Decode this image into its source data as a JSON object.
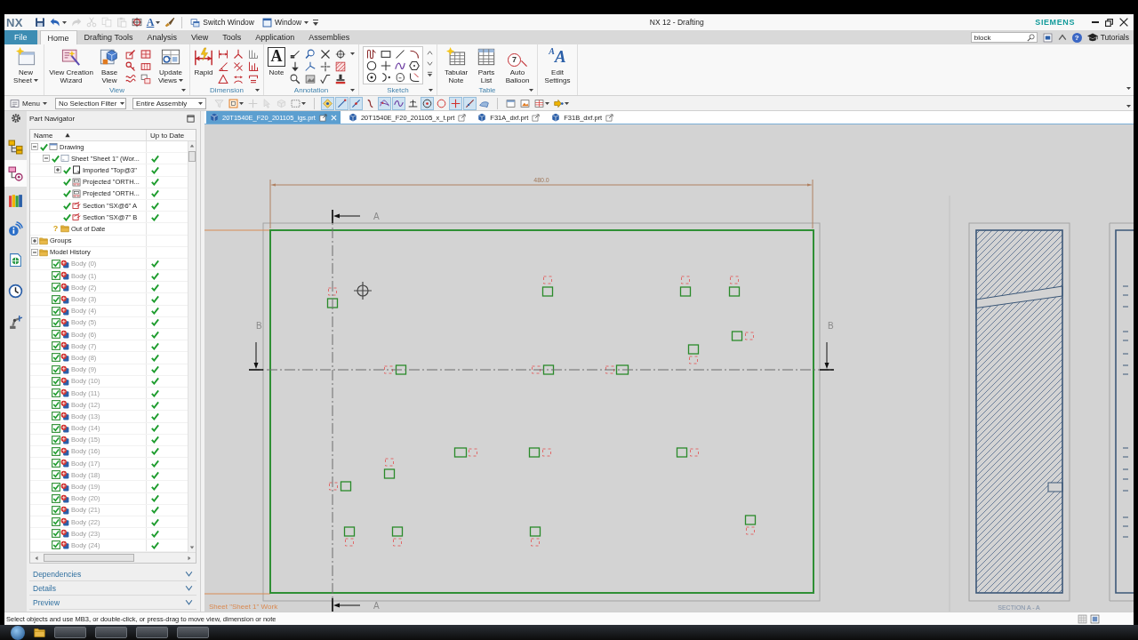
{
  "window": {
    "logo": "NX",
    "title": "NX 12 - Drafting",
    "brand": "SIEMENS"
  },
  "quick_access": {
    "tools": [
      {
        "kind": "save",
        "disabled": false
      },
      {
        "kind": "undo",
        "disabled": false
      },
      {
        "kind": "redo",
        "disabled": true
      },
      {
        "kind": "cut",
        "disabled": true
      },
      {
        "kind": "copy",
        "disabled": true
      },
      {
        "kind": "paste",
        "disabled": true
      },
      {
        "kind": "repeat",
        "disabled": false
      },
      {
        "kind": "text_style",
        "glyph": "A",
        "disabled": false
      },
      {
        "kind": "brush",
        "disabled": false
      }
    ],
    "buttons": [
      {
        "kind": "switch_window",
        "label": "Switch Window"
      },
      {
        "kind": "window",
        "label": "Window"
      }
    ]
  },
  "ribbon": {
    "tabs": [
      {
        "kind": "file",
        "label": "File",
        "selected": false
      },
      {
        "kind": "tab",
        "label": "Home",
        "selected": true
      },
      {
        "kind": "tab",
        "label": "Drafting Tools",
        "selected": false
      },
      {
        "kind": "tab",
        "label": "Analysis",
        "selected": false
      },
      {
        "kind": "tab",
        "label": "View",
        "selected": false
      },
      {
        "kind": "tab",
        "label": "Tools",
        "selected": false
      },
      {
        "kind": "tab",
        "label": "Application",
        "selected": false
      },
      {
        "kind": "tab",
        "label": "Assemblies",
        "selected": false
      }
    ],
    "search": {
      "value": "block"
    },
    "help": "?",
    "tutorials": "Tutorials",
    "groups": [
      {
        "kind": "sheet",
        "buttons": [
          {
            "kind": "new_sheet",
            "label": "New Sheet",
            "dropdown": true
          }
        ]
      },
      {
        "kind": "view",
        "label": "View",
        "buttons": [
          {
            "kind": "view_wizard",
            "label": "View Creation Wizard",
            "dropdown": false
          },
          {
            "kind": "base_view",
            "label": "Base View",
            "dropdown": false
          },
          {
            "kind": "update_views",
            "label": "Update Views",
            "dropdown": true
          }
        ]
      },
      {
        "kind": "dimension",
        "label": "Dimension",
        "buttons": [
          {
            "kind": "rapid",
            "label": "Rapid",
            "dropdown": false
          }
        ]
      },
      {
        "kind": "annotation",
        "label": "Annotation",
        "buttons": [
          {
            "kind": "note",
            "label": "Note",
            "glyph": "A",
            "dropdown": false
          }
        ]
      },
      {
        "kind": "sketch",
        "label": "Sketch"
      },
      {
        "kind": "table",
        "label": "Table",
        "buttons": [
          {
            "kind": "tabular_note",
            "label": "Tabular Note",
            "dropdown": false
          },
          {
            "kind": "parts_list",
            "label": "Parts List",
            "dropdown": false
          },
          {
            "kind": "auto_balloon",
            "label": "Auto Balloon",
            "glyph": "7",
            "dropdown": false
          }
        ]
      },
      {
        "kind": "settings",
        "buttons": [
          {
            "kind": "edit_settings",
            "label": "Edit Settings",
            "glyph": "A",
            "glyph_small": "A",
            "dropdown": false
          }
        ]
      }
    ]
  },
  "selection_bar": {
    "menu": "Menu",
    "filter": "No Selection Filter",
    "scope": "Entire Assembly",
    "tools": [
      {
        "kind": "filter_reset",
        "on": false,
        "disabled": true
      },
      {
        "kind": "select_all",
        "on": false,
        "disabled": false
      },
      {
        "kind": "deselect",
        "on": false,
        "disabled": true
      },
      {
        "kind": "select_feature",
        "on": false,
        "disabled": true
      },
      {
        "kind": "select_body",
        "on": false,
        "disabled": true
      },
      {
        "kind": "rectangle",
        "on": false,
        "disabled": false
      },
      {
        "kind": "snap_enable",
        "on": true,
        "disabled": false
      },
      {
        "kind": "end_point",
        "on": true,
        "disabled": false
      },
      {
        "kind": "mid_point",
        "on": true,
        "disabled": false
      },
      {
        "kind": "control_point",
        "on": false,
        "disabled": false
      },
      {
        "kind": "intersection",
        "on": true,
        "disabled": false
      },
      {
        "kind": "tangent",
        "on": true,
        "disabled": false
      },
      {
        "kind": "perpendicular",
        "on": false,
        "disabled": false
      },
      {
        "kind": "center",
        "on": true,
        "disabled": false
      },
      {
        "kind": "quadrant",
        "on": false,
        "disabled": false
      },
      {
        "kind": "existing_point",
        "on": true,
        "disabled": false
      },
      {
        "kind": "on_curve",
        "on": true,
        "disabled": false
      },
      {
        "kind": "on_surface",
        "on": false,
        "disabled": false
      },
      {
        "kind": "view_a",
        "on": false,
        "disabled": false
      },
      {
        "kind": "view_b",
        "on": false,
        "disabled": false
      },
      {
        "kind": "layout",
        "on": false,
        "disabled": false
      },
      {
        "kind": "orient",
        "on": false,
        "disabled": false
      }
    ]
  },
  "resource_bar": [
    {
      "kind": "assembly",
      "selected": false
    },
    {
      "kind": "part",
      "selected": true
    },
    {
      "kind": "library",
      "selected": false
    },
    {
      "kind": "info",
      "selected": false
    },
    {
      "kind": "web",
      "selected": false
    },
    {
      "kind": "history",
      "selected": false
    },
    {
      "kind": "process",
      "selected": false
    }
  ],
  "navigator": {
    "title": "Part Navigator",
    "columns": [
      {
        "label": "Name",
        "sorted": true
      },
      {
        "label": "Up to Date",
        "sorted": false
      }
    ],
    "tree": [
      {
        "kind": "drawing",
        "label": "Drawing",
        "expanded": true,
        "checked": true,
        "up_to_date": false,
        "children": [
          {
            "kind": "sheet",
            "label": "Sheet \"Sheet 1\" (Wor...",
            "expanded": true,
            "checked": true,
            "up_to_date": true,
            "children": [
              {
                "kind": "imported",
                "label": "Imported \"Top@3\"",
                "expanded": false,
                "checked": true,
                "up_to_date": true
              },
              {
                "kind": "projected",
                "label": "Projected \"ORTH...",
                "checked": true,
                "up_to_date": true
              },
              {
                "kind": "projected",
                "label": "Projected \"ORTH...",
                "checked": true,
                "up_to_date": true
              },
              {
                "kind": "section",
                "label": "Section \"SX@6\" A",
                "checked": true,
                "up_to_date": true
              },
              {
                "kind": "section",
                "label": "Section \"SX@7\" B",
                "checked": true,
                "up_to_date": true
              }
            ]
          },
          {
            "kind": "out_of_date",
            "label": "Out of Date",
            "glyph": "?",
            "checked": false,
            "up_to_date": false
          }
        ]
      },
      {
        "kind": "folder",
        "label": "Groups",
        "expanded": false,
        "checked": false,
        "up_to_date": false
      },
      {
        "kind": "folder",
        "label": "Model History",
        "expanded": true,
        "checked": false,
        "up_to_date": false,
        "children": [
          {
            "kind": "body",
            "label": "Body (0)",
            "checked": true,
            "up_to_date": true
          },
          {
            "kind": "body",
            "label": "Body (1)",
            "checked": true,
            "up_to_date": true
          },
          {
            "kind": "body",
            "label": "Body (2)",
            "checked": true,
            "up_to_date": true
          },
          {
            "kind": "body",
            "label": "Body (3)",
            "checked": true,
            "up_to_date": true
          },
          {
            "kind": "body",
            "label": "Body (4)",
            "checked": true,
            "up_to_date": true
          },
          {
            "kind": "body",
            "label": "Body (5)",
            "checked": true,
            "up_to_date": true
          },
          {
            "kind": "body",
            "label": "Body (6)",
            "checked": true,
            "up_to_date": true
          },
          {
            "kind": "body",
            "label": "Body (7)",
            "checked": true,
            "up_to_date": true
          },
          {
            "kind": "body",
            "label": "Body (8)",
            "checked": true,
            "up_to_date": true
          },
          {
            "kind": "body",
            "label": "Body (9)",
            "checked": true,
            "up_to_date": true
          },
          {
            "kind": "body",
            "label": "Body (10)",
            "checked": true,
            "up_to_date": true
          },
          {
            "kind": "body",
            "label": "Body (11)",
            "checked": true,
            "up_to_date": true
          },
          {
            "kind": "body",
            "label": "Body (12)",
            "checked": true,
            "up_to_date": true
          },
          {
            "kind": "body",
            "label": "Body (13)",
            "checked": true,
            "up_to_date": true
          },
          {
            "kind": "body",
            "label": "Body (14)",
            "checked": true,
            "up_to_date": true
          },
          {
            "kind": "body",
            "label": "Body (15)",
            "checked": true,
            "up_to_date": true
          },
          {
            "kind": "body",
            "label": "Body (16)",
            "checked": true,
            "up_to_date": true
          },
          {
            "kind": "body",
            "label": "Body (17)",
            "checked": true,
            "up_to_date": true
          },
          {
            "kind": "body",
            "label": "Body (18)",
            "checked": true,
            "up_to_date": true
          },
          {
            "kind": "body",
            "label": "Body (19)",
            "checked": true,
            "up_to_date": true
          },
          {
            "kind": "body",
            "label": "Body (20)",
            "checked": true,
            "up_to_date": true
          },
          {
            "kind": "body",
            "label": "Body (21)",
            "checked": true,
            "up_to_date": true
          },
          {
            "kind": "body",
            "label": "Body (22)",
            "checked": true,
            "up_to_date": true
          },
          {
            "kind": "body",
            "label": "Body (23)",
            "checked": true,
            "up_to_date": true
          },
          {
            "kind": "body",
            "label": "Body (24)",
            "checked": true,
            "up_to_date": true
          }
        ]
      }
    ],
    "panels": [
      {
        "label": "Dependencies",
        "expanded": false
      },
      {
        "label": "Details",
        "expanded": false
      },
      {
        "label": "Preview",
        "expanded": false
      }
    ]
  },
  "documents": {
    "tabs": [
      {
        "label": "20T1540E_F20_201105_igs.prt",
        "selected": true
      },
      {
        "label": "20T1540E_F20_201105_x_t.prt",
        "selected": false
      },
      {
        "label": "F31A_dxf.prt",
        "selected": false
      },
      {
        "label": "F31B_dxf.prt",
        "selected": false
      }
    ]
  },
  "drawing": {
    "dimension": "480.0",
    "section_lines": [
      {
        "kind": "vertical",
        "labels": [
          "A",
          "A"
        ]
      },
      {
        "kind": "horizontal",
        "labels": [
          "B",
          "B"
        ]
      }
    ],
    "sheet_label": "Sheet \"Sheet 1\" Work",
    "section_caption": "SECTION A - A"
  },
  "status_bar": {
    "message": "Select objects and use MB3, or double-click, or press-drag to move view, dimension or note"
  }
}
